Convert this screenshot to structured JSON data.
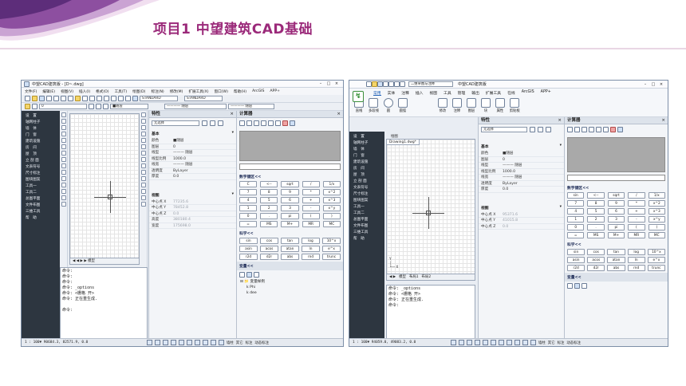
{
  "slide": {
    "title": "项目1  中望建筑CAD基础"
  },
  "win1": {
    "title": "中望CAD建筑版 - [D~.dwg]",
    "menu": [
      "文件(F)",
      "编辑(E)",
      "视图(V)",
      "插入(I)",
      "格式(O)",
      "工具(T)",
      "绘图(D)",
      "标注(N)",
      "修改(M)",
      "扩展工具(X)",
      "窗口(W)",
      "帮助(H)",
      "ArcGIS",
      "APP+"
    ],
    "style_dropdown": "STANDARD",
    "style_dropdown2": "STANDARD",
    "layer_dropdown": "0",
    "color_dropdown": "■随层",
    "linetype_dropdown": "———— 随层",
    "lineweight_dropdown": "———— 随层",
    "nav": [
      "设　置",
      "轴网柱子",
      "墙　体",
      "门　窗",
      "建筑设施",
      "房　间",
      "屋　顶",
      "立 剖 面",
      "文表符号",
      "尺寸标注",
      "图块图案",
      "工具一",
      "工具二",
      "总图平面",
      "文件布图",
      "三维工具",
      "帮　助"
    ],
    "drawing_tab": "模型",
    "prop_panel": {
      "title": "特性",
      "select_label": "无选择",
      "basic": "基本",
      "rows": [
        {
          "k": "颜色",
          "v": "■随层"
        },
        {
          "k": "图层",
          "v": "0"
        },
        {
          "k": "线型",
          "v": "——— 随层"
        },
        {
          "k": "线型比例",
          "v": "1000.0"
        },
        {
          "k": "线宽",
          "v": "——— 随层"
        },
        {
          "k": "透明度",
          "v": "ByLayer"
        },
        {
          "k": "厚度",
          "v": "0.0"
        }
      ],
      "view": "视图",
      "view_rows": [
        {
          "k": "中心点 X",
          "v": "77235.6"
        },
        {
          "k": "中心点 Y",
          "v": "78452.8"
        },
        {
          "k": "中心点 Z",
          "v": "0.0"
        },
        {
          "k": "高度",
          "v": "380180.4"
        },
        {
          "k": "宽度",
          "v": "175698.0"
        }
      ]
    },
    "calc": {
      "title": "计算器",
      "numpad_title": "数字键区<<",
      "numpad": [
        "C",
        "<--",
        "sqrt",
        "/",
        "1/x",
        "7",
        "8",
        "9",
        "*",
        "x^2",
        "4",
        "5",
        "6",
        "+",
        "x^3",
        "1",
        "2",
        "3",
        "-",
        "x^y",
        "0",
        ".",
        "pi",
        "(",
        ")",
        "=",
        "MS",
        "M+",
        "MR",
        "MC"
      ],
      "sci_title": "科学<<",
      "sci": [
        "sin",
        "cos",
        "tan",
        "log",
        "10^x",
        "asin",
        "acos",
        "atan",
        "ln",
        "e^x",
        "r2d",
        "d2r",
        "abs",
        "rnd",
        "trunc"
      ],
      "var_title": "变量<<",
      "var_tree": [
        "⊟ 📁 变量样例",
        "k  Phi",
        "k  dee"
      ]
    },
    "command_lines": [
      "命令:",
      "命令:",
      "命令:",
      "命令: _options",
      "命令: <栅格 开>",
      "命令: 正在重生成.",
      "",
      "命令:"
    ],
    "coords": "1 : 100▼  90684.3, 82571.9, 0.0",
    "status_labels": [
      "墙柱",
      "其它",
      "标注",
      "动态标注"
    ]
  },
  "win2": {
    "title": "中望CAD建筑版",
    "workspace": "二维草图与注释",
    "tabs": [
      "常用",
      "实体",
      "注释",
      "插入",
      "视图",
      "工具",
      "管理",
      "输出",
      "扩展工具",
      "在线",
      "ArcGIS",
      "APP+"
    ],
    "tools": [
      "直线",
      "多段线",
      "圆",
      "圆弧",
      "修改",
      "注释",
      "图层",
      "块",
      "属性",
      "剪贴板"
    ],
    "nav": [
      "设　置",
      "轴网柱子",
      "墙　体",
      "门　窗",
      "建筑设施",
      "房　间",
      "屋　顶",
      "立 剖 面",
      "文表符号",
      "尺寸标注",
      "图块图案",
      "工具一",
      "工具二",
      "总图平面",
      "文件布图",
      "三维工具",
      "帮　助"
    ],
    "doc_tab": "Drawing1.dwg*",
    "top_label": "绘图",
    "layout_tabs": [
      "模型",
      "布局1",
      "布局2"
    ],
    "prop_panel": {
      "title": "特性",
      "select_label": "无选择",
      "basic": "基本",
      "rows": [
        {
          "k": "颜色",
          "v": "■随层"
        },
        {
          "k": "图层",
          "v": "0"
        },
        {
          "k": "线型",
          "v": "——— 随层"
        },
        {
          "k": "线型比例",
          "v": "1000.0"
        },
        {
          "k": "线宽",
          "v": "——— 随层"
        },
        {
          "k": "透明度",
          "v": "ByLayer"
        },
        {
          "k": "厚度",
          "v": "0.0"
        }
      ],
      "view": "视图",
      "view_rows": [
        {
          "k": "中心点 X",
          "v": "95371.6"
        },
        {
          "k": "中心点 Y",
          "v": "41015.8"
        },
        {
          "k": "中心点 Z",
          "v": "0.0"
        }
      ]
    },
    "calc": {
      "title": "计算器",
      "numpad_title": "数字键区<<",
      "numpad": [
        "sin",
        "<--",
        "sqrt",
        "/",
        "1/x",
        "7",
        "8",
        "9",
        "*",
        "x^2",
        "4",
        "5",
        "6",
        "+",
        "x^3",
        "1",
        "2",
        "3",
        "-",
        "x^y",
        "0",
        ".",
        "pi",
        "(",
        ")",
        "=",
        "MS",
        "M+",
        "MR",
        "MC"
      ],
      "sci_title": "科学<<",
      "sci": [
        "sin",
        "cos",
        "tan",
        "log",
        "10^x",
        "asin",
        "acos",
        "atan",
        "ln",
        "e^x",
        "r2d",
        "d2r",
        "abs",
        "rnd",
        "trunc"
      ],
      "var_title": "变量<<"
    },
    "command_lines": [
      "命令: _options",
      "命令: <栅格 开>",
      "命令: 正在重生成.",
      "命令:"
    ],
    "coords": "1 : 100▼  94059.0, 49083.2, 0.0",
    "status_labels": [
      "墙柱",
      "其它",
      "标注",
      "动态标注"
    ]
  }
}
